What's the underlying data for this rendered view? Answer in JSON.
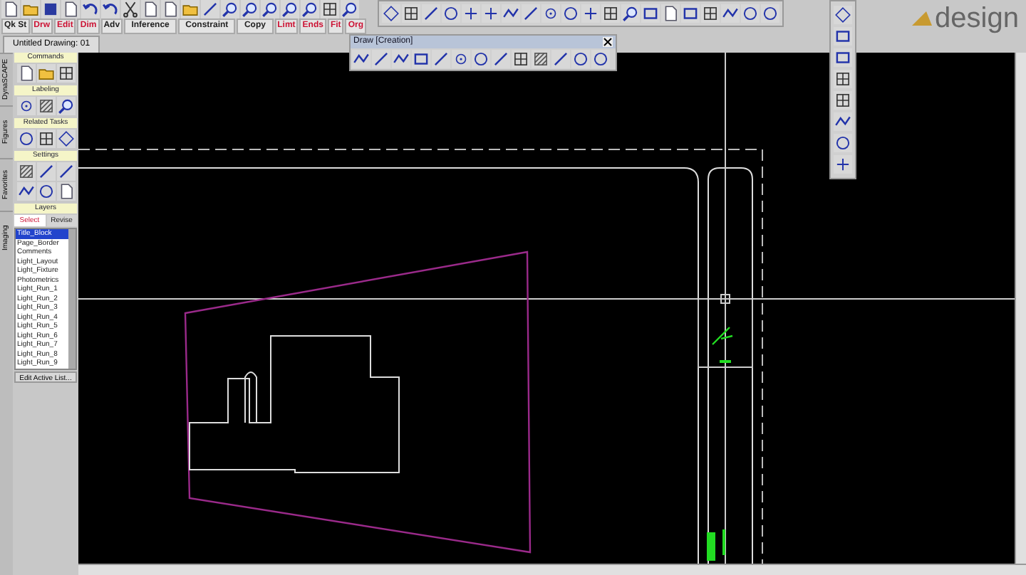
{
  "menu_tabs": [
    {
      "label": "Qk St",
      "color": "#222222"
    },
    {
      "label": "Drw",
      "color": "#cc1133"
    },
    {
      "label": "Edit",
      "color": "#cc1133"
    },
    {
      "label": "Dim",
      "color": "#cc1133"
    },
    {
      "label": "Adv",
      "color": "#222222"
    },
    {
      "label": "Inference",
      "color": "#222222"
    },
    {
      "label": "Constraint",
      "color": "#222222"
    },
    {
      "label": "Copy",
      "color": "#222222"
    },
    {
      "label": "Limt",
      "color": "#cc1133"
    },
    {
      "label": "Ends",
      "color": "#cc1133"
    },
    {
      "label": "Fit",
      "color": "#cc1133"
    },
    {
      "label": "Org",
      "color": "#cc1133"
    }
  ],
  "document_tab": "Untitled Drawing: 01",
  "draw_window": {
    "title": "Draw [Creation]"
  },
  "logo": "design",
  "side_tabs": [
    "DynaSCAPE",
    "Figures",
    "Favorites",
    "Imaging"
  ],
  "panel_sections": [
    "Commands",
    "Labeling",
    "Related Tasks",
    "Settings",
    "Layers"
  ],
  "layer_buttons": [
    {
      "label": "Select",
      "selected": true
    },
    {
      "label": "Revise",
      "selected": false
    }
  ],
  "layers": [
    {
      "name": "Title_Block",
      "selected": true
    },
    {
      "name": "Page_Border",
      "selected": false
    },
    {
      "name": "Comments",
      "selected": false
    },
    {
      "name": "Light_Layout",
      "selected": false
    },
    {
      "name": "Light_Fixture",
      "selected": false
    },
    {
      "name": "Photometrics",
      "selected": false
    },
    {
      "name": "Light_Run_1",
      "selected": false
    },
    {
      "name": "Light_Run_2",
      "selected": false
    },
    {
      "name": "Light_Run_3",
      "selected": false
    },
    {
      "name": "Light_Run_4",
      "selected": false
    },
    {
      "name": "Light_Run_5",
      "selected": false
    },
    {
      "name": "Light_Run_6",
      "selected": false
    },
    {
      "name": "Light_Run_7",
      "selected": false
    },
    {
      "name": "Light_Run_8",
      "selected": false
    },
    {
      "name": "Light_Run_9",
      "selected": false
    }
  ],
  "edit_list_button": "Edit Active List..."
}
